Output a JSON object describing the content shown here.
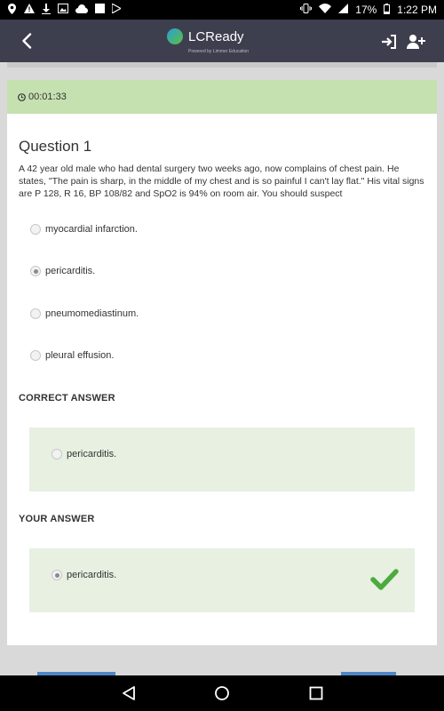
{
  "status_bar": {
    "battery": "17%",
    "time": "1:22 PM"
  },
  "app_bar": {
    "logo_text": "LCReady",
    "logo_sub": "Powered by Limmer Education"
  },
  "timer": "00:01:33",
  "question": {
    "title": "Question 1",
    "text": "A 42 year old male who had dental surgery two weeks ago, now complains of chest pain. He states, \"The pain is sharp, in the middle of my chest and is so painful I can't lay flat.\" His vital signs are P 128, R 16, BP 108/82 and SpO2 is 94% on room air. You should suspect",
    "options": [
      {
        "label": "myocardial infarction."
      },
      {
        "label": "pericarditis."
      },
      {
        "label": "pneumomediastinum."
      },
      {
        "label": "pleural effusion."
      }
    ]
  },
  "correct_answer": {
    "heading": "CORRECT ANSWER",
    "label": "pericarditis."
  },
  "your_answer": {
    "heading": "YOUR ANSWER",
    "label": "pericarditis."
  },
  "colors": {
    "app_bar": "#3d3f4f",
    "timer_bg": "#c6e1b0",
    "answer_bg": "#e7f0e1",
    "check": "#4caa3f"
  }
}
